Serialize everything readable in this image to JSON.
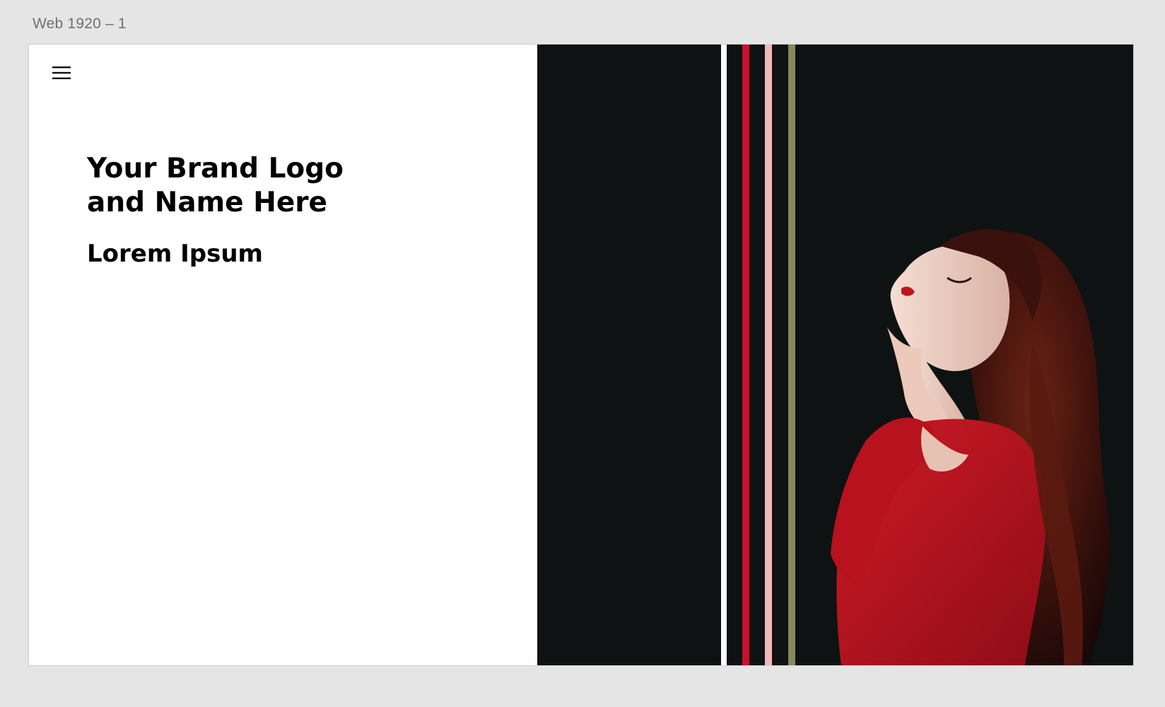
{
  "app": {
    "artboard_label": "Web 1920 – 1"
  },
  "header": {
    "menu_icon": "hamburger-menu-icon"
  },
  "hero": {
    "title_line1": "Your Brand Logo",
    "title_line2": "and Name Here",
    "subtitle": "Lorem Ipsum"
  },
  "colors": {
    "canvas": "#e5e5e5",
    "panel_dark": "#0e1212",
    "stripe_white": "#ffffff",
    "stripe_red": "#c8102e",
    "stripe_pink": "#f2b8b8",
    "stripe_olive": "#858a5c",
    "dress_red": "#b3121f",
    "hair": "#4a1510"
  }
}
